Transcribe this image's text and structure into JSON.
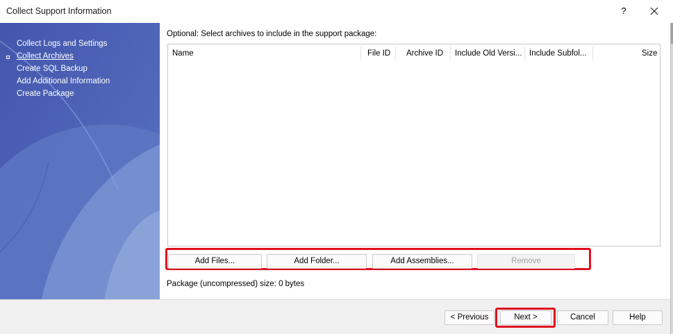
{
  "window": {
    "title": "Collect Support Information",
    "help_label": "?"
  },
  "steps": [
    {
      "label": "Collect Logs and Settings",
      "current": false
    },
    {
      "label": "Collect Archives",
      "current": true
    },
    {
      "label": "Create SQL Backup",
      "current": false
    },
    {
      "label": "Add Additional Information",
      "current": false
    },
    {
      "label": "Create Package",
      "current": false
    }
  ],
  "main": {
    "instruction": "Optional: Select archives to include in the support package:",
    "columns": [
      "Name",
      "File ID",
      "Archive ID",
      "Include Old Versi...",
      "Include Subfol...",
      "Size"
    ],
    "rows": [],
    "package_size": "Package (uncompressed) size: 0 bytes"
  },
  "actions": {
    "add_files": "Add Files...",
    "add_folder": "Add Folder...",
    "add_assemblies": "Add Assemblies...",
    "remove": "Remove"
  },
  "nav": {
    "previous": "< Previous",
    "next": "Next >",
    "cancel": "Cancel",
    "help": "Help"
  },
  "colors": {
    "sidebar": "#4e64b5",
    "highlight": "#e0101c"
  }
}
